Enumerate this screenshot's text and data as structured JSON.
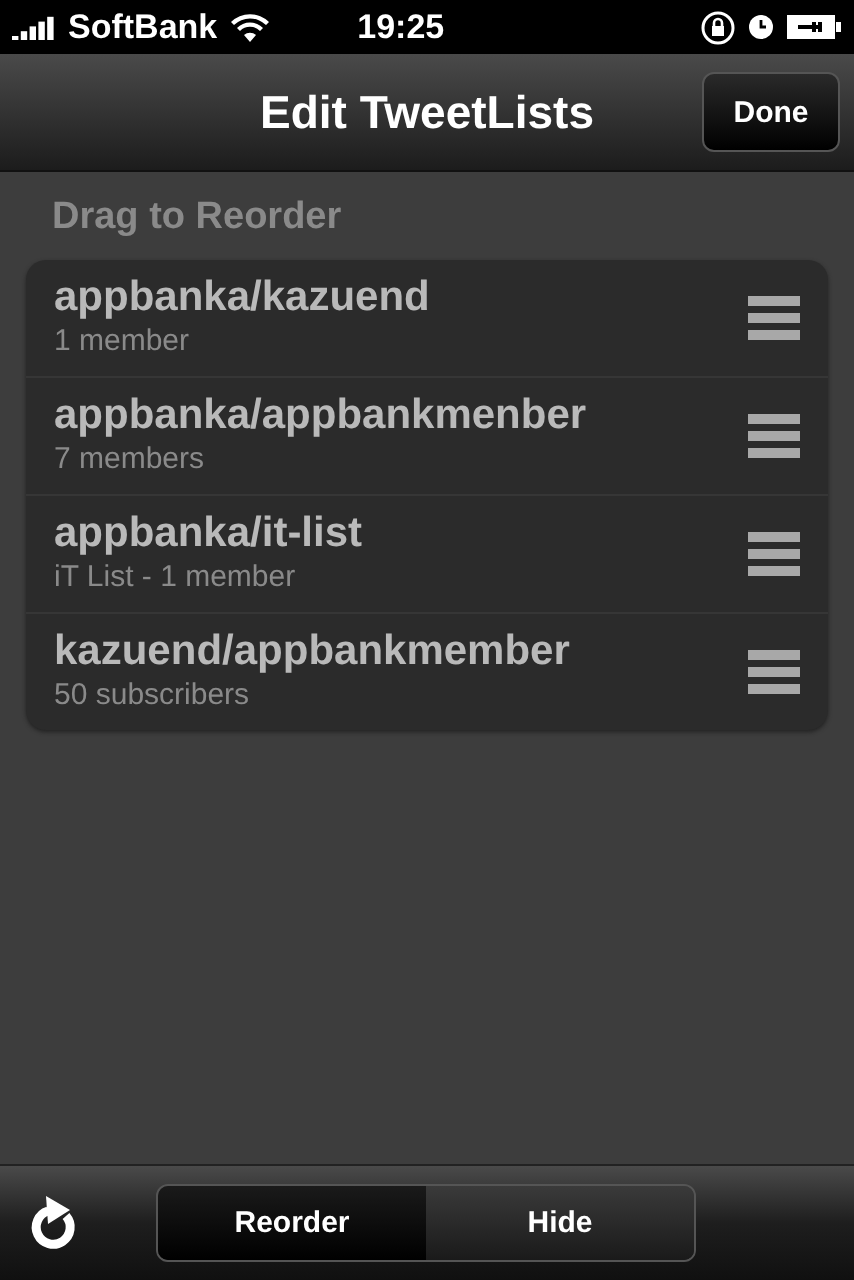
{
  "status_bar": {
    "carrier": "SoftBank",
    "time": "19:25"
  },
  "nav_bar": {
    "title": "Edit TweetLists",
    "done_button": "Done"
  },
  "section_header": "Drag to Reorder",
  "lists": [
    {
      "name": "appbanka/kazuend",
      "detail": "1 member"
    },
    {
      "name": "appbanka/appbankmenber",
      "detail": "7 members"
    },
    {
      "name": "appbanka/it-list",
      "detail": "iT List - 1 member"
    },
    {
      "name": "kazuend/appbankmember",
      "detail": "50 subscribers"
    }
  ],
  "toolbar": {
    "segments": [
      {
        "label": "Reorder",
        "selected": true
      },
      {
        "label": "Hide",
        "selected": false
      }
    ]
  }
}
